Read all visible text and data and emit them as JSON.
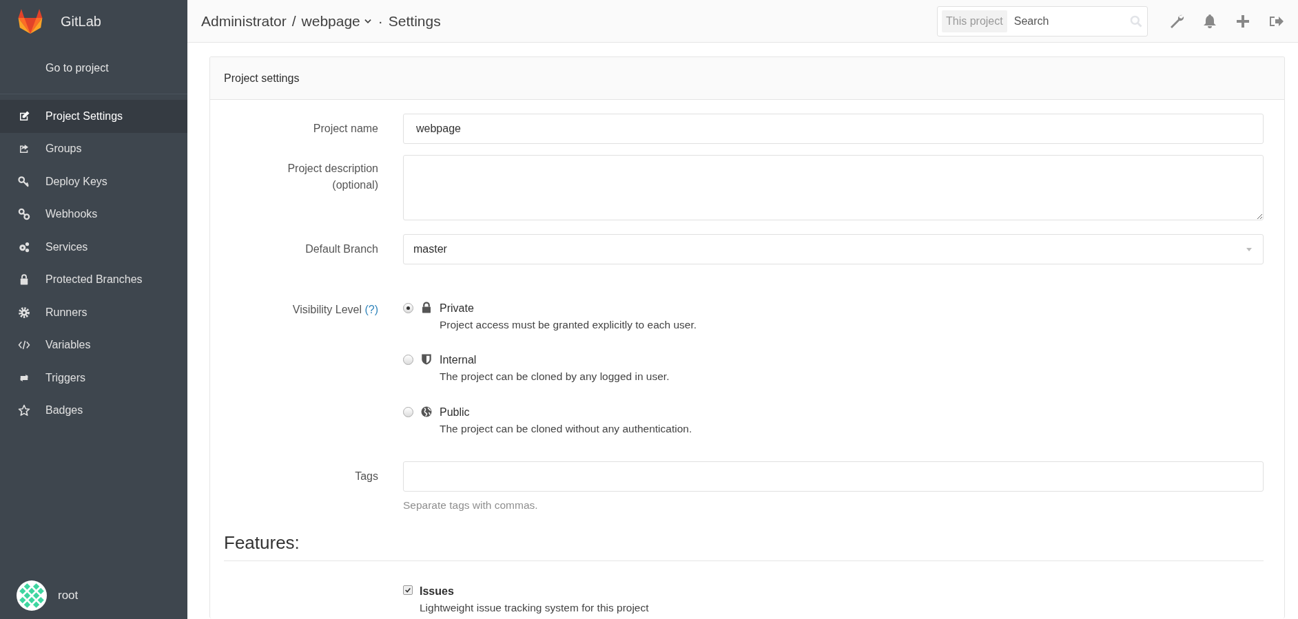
{
  "sidebar": {
    "brand": "GitLab",
    "go_to_project": "Go to project",
    "items": [
      {
        "label": "Project Settings",
        "selected": true
      },
      {
        "label": "Groups",
        "selected": false
      },
      {
        "label": "Deploy Keys",
        "selected": false
      },
      {
        "label": "Webhooks",
        "selected": false
      },
      {
        "label": "Services",
        "selected": false
      },
      {
        "label": "Protected Branches",
        "selected": false
      },
      {
        "label": "Runners",
        "selected": false
      },
      {
        "label": "Variables",
        "selected": false
      },
      {
        "label": "Triggers",
        "selected": false
      },
      {
        "label": "Badges",
        "selected": false
      }
    ],
    "user": {
      "name": "root"
    }
  },
  "header": {
    "group": "Administrator",
    "separator": "/",
    "project": "webpage",
    "page_separator": "·",
    "page": "Settings",
    "search": {
      "scope": "This project",
      "placeholder": "Search"
    }
  },
  "card": {
    "title": "Project settings",
    "project_name": {
      "label": "Project name",
      "value": "webpage"
    },
    "description": {
      "label": "Project description",
      "hint": "(optional)"
    },
    "default_branch": {
      "label": "Default Branch",
      "value": "master"
    },
    "visibility": {
      "label": "Visibility Level",
      "help": "(?)",
      "options": [
        {
          "label": "Private",
          "description": "Project access must be granted explicitly to each user.",
          "selected": true
        },
        {
          "label": "Internal",
          "description": "The project can be cloned by any logged in user.",
          "selected": false
        },
        {
          "label": "Public",
          "description": "The project can be cloned without any authentication.",
          "selected": false
        }
      ]
    },
    "tags": {
      "label": "Tags",
      "hint": "Separate tags with commas."
    },
    "features": {
      "heading": "Features:",
      "items": [
        {
          "label": "Issues",
          "description": "Lightweight issue tracking system for this project",
          "checked": true
        }
      ]
    }
  }
}
